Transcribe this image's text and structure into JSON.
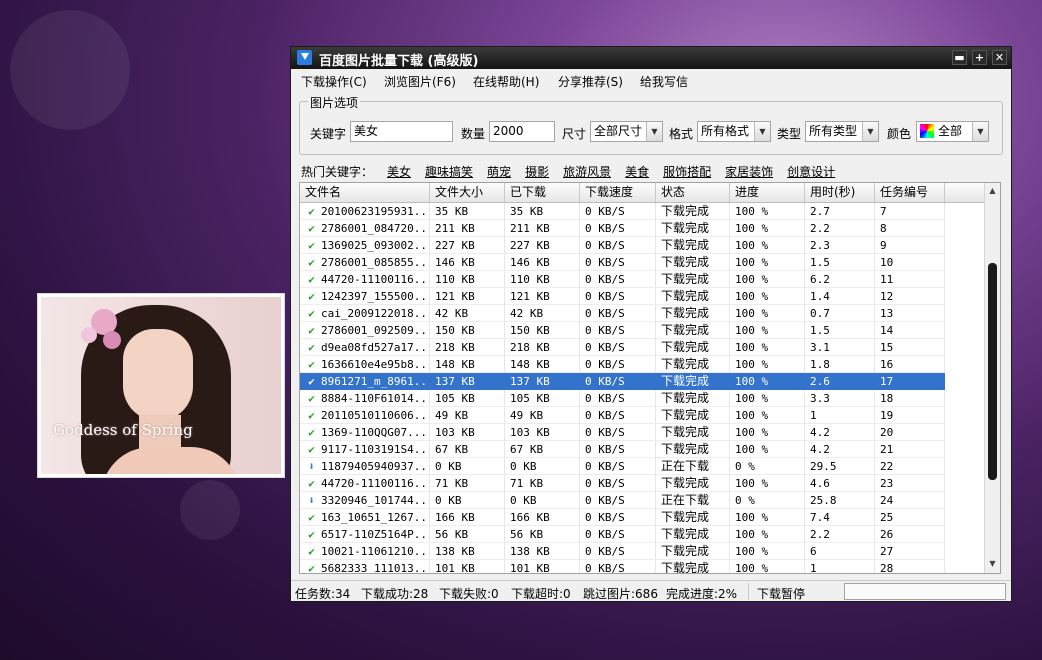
{
  "window": {
    "title": "百度图片批量下载 (高级版)",
    "controls": {
      "minimize": "▬",
      "maximize": "+",
      "close": "✕"
    }
  },
  "menu": [
    "下载操作(C)",
    "浏览图片(F6)",
    "在线帮助(H)",
    "分享推荐(S)",
    "给我写信"
  ],
  "options": {
    "legend": "图片选项",
    "keyword_label": "关键字",
    "keyword_value": "美女",
    "count_label": "数量",
    "count_value": "2000",
    "size_label": "尺寸",
    "size_value": "全部尺寸",
    "format_label": "格式",
    "format_value": "所有格式",
    "type_label": "类型",
    "type_value": "所有类型",
    "color_label": "颜色",
    "color_value": "全部"
  },
  "hot_keywords": {
    "label": "热门关键字：",
    "items": [
      "美女",
      "趣味搞笑",
      "萌宠",
      "摄影",
      "旅游风景",
      "美食",
      "服饰搭配",
      "家居装饰",
      "创意设计"
    ]
  },
  "table": {
    "columns": [
      "文件名",
      "文件大小",
      "已下载",
      "下载速度",
      "状态",
      "进度",
      "用时(秒)",
      "任务编号"
    ],
    "selected_index": 10,
    "rows": [
      {
        "icon": "check-icon",
        "name": "20100623195931...",
        "size": "35 KB",
        "done": "35 KB",
        "speed": "0 KB/S",
        "status": "下载完成",
        "progress": "100 %",
        "time": "2.7",
        "id": "7"
      },
      {
        "icon": "check-icon",
        "name": "2786001_084720...",
        "size": "211 KB",
        "done": "211 KB",
        "speed": "0 KB/S",
        "status": "下载完成",
        "progress": "100 %",
        "time": "2.2",
        "id": "8"
      },
      {
        "icon": "check-icon",
        "name": "1369025_093002...",
        "size": "227 KB",
        "done": "227 KB",
        "speed": "0 KB/S",
        "status": "下载完成",
        "progress": "100 %",
        "time": "2.3",
        "id": "9"
      },
      {
        "icon": "check-icon",
        "name": "2786001_085855...",
        "size": "146 KB",
        "done": "146 KB",
        "speed": "0 KB/S",
        "status": "下载完成",
        "progress": "100 %",
        "time": "1.5",
        "id": "10"
      },
      {
        "icon": "check-icon",
        "name": "44720-11100116...",
        "size": "110 KB",
        "done": "110 KB",
        "speed": "0 KB/S",
        "status": "下载完成",
        "progress": "100 %",
        "time": "6.2",
        "id": "11"
      },
      {
        "icon": "check-icon",
        "name": "1242397_155500...",
        "size": "121 KB",
        "done": "121 KB",
        "speed": "0 KB/S",
        "status": "下载完成",
        "progress": "100 %",
        "time": "1.4",
        "id": "12"
      },
      {
        "icon": "check-icon",
        "name": "cai_2009122018...",
        "size": "42 KB",
        "done": "42 KB",
        "speed": "0 KB/S",
        "status": "下载完成",
        "progress": "100 %",
        "time": "0.7",
        "id": "13"
      },
      {
        "icon": "check-icon",
        "name": "2786001_092509...",
        "size": "150 KB",
        "done": "150 KB",
        "speed": "0 KB/S",
        "status": "下载完成",
        "progress": "100 %",
        "time": "1.5",
        "id": "14"
      },
      {
        "icon": "check-icon",
        "name": "d9ea08fd527a17...",
        "size": "218 KB",
        "done": "218 KB",
        "speed": "0 KB/S",
        "status": "下载完成",
        "progress": "100 %",
        "time": "3.1",
        "id": "15"
      },
      {
        "icon": "check-icon",
        "name": "1636610e4e95b8...",
        "size": "148 KB",
        "done": "148 KB",
        "speed": "0 KB/S",
        "status": "下载完成",
        "progress": "100 %",
        "time": "1.8",
        "id": "16"
      },
      {
        "icon": "check-icon",
        "name": "8961271_m_8961...",
        "size": "137 KB",
        "done": "137 KB",
        "speed": "0 KB/S",
        "status": "下载完成",
        "progress": "100 %",
        "time": "2.6",
        "id": "17"
      },
      {
        "icon": "check-icon",
        "name": "8884-110F61014...",
        "size": "105 KB",
        "done": "105 KB",
        "speed": "0 KB/S",
        "status": "下载完成",
        "progress": "100 %",
        "time": "3.3",
        "id": "18"
      },
      {
        "icon": "check-icon",
        "name": "20110510110606...",
        "size": "49 KB",
        "done": "49 KB",
        "speed": "0 KB/S",
        "status": "下载完成",
        "progress": "100 %",
        "time": "1",
        "id": "19"
      },
      {
        "icon": "check-icon",
        "name": "1369-110QQG07...",
        "size": "103 KB",
        "done": "103 KB",
        "speed": "0 KB/S",
        "status": "下载完成",
        "progress": "100 %",
        "time": "4.2",
        "id": "20"
      },
      {
        "icon": "check-icon",
        "name": "9117-1103191S4...",
        "size": "67 KB",
        "done": "67 KB",
        "speed": "0 KB/S",
        "status": "下载完成",
        "progress": "100 %",
        "time": "4.2",
        "id": "21"
      },
      {
        "icon": "download-icon",
        "name": "11879405940937...",
        "size": "0 KB",
        "done": "0 KB",
        "speed": "0 KB/S",
        "status": "正在下载",
        "progress": "0 %",
        "time": "29.5",
        "id": "22"
      },
      {
        "icon": "check-icon",
        "name": "44720-11100116...",
        "size": "71 KB",
        "done": "71 KB",
        "speed": "0 KB/S",
        "status": "下载完成",
        "progress": "100 %",
        "time": "4.6",
        "id": "23"
      },
      {
        "icon": "download-icon",
        "name": "3320946_101744...",
        "size": "0 KB",
        "done": "0 KB",
        "speed": "0 KB/S",
        "status": "正在下载",
        "progress": "0 %",
        "time": "25.8",
        "id": "24"
      },
      {
        "icon": "check-icon",
        "name": "163_10651_1267...",
        "size": "166 KB",
        "done": "166 KB",
        "speed": "0 KB/S",
        "status": "下载完成",
        "progress": "100 %",
        "time": "7.4",
        "id": "25"
      },
      {
        "icon": "check-icon",
        "name": "6517-110Z5164P...",
        "size": "56 KB",
        "done": "56 KB",
        "speed": "0 KB/S",
        "status": "下载完成",
        "progress": "100 %",
        "time": "2.2",
        "id": "26"
      },
      {
        "icon": "check-icon",
        "name": "10021-11061210...",
        "size": "138 KB",
        "done": "138 KB",
        "speed": "0 KB/S",
        "status": "下载完成",
        "progress": "100 %",
        "time": "6",
        "id": "27"
      },
      {
        "icon": "check-icon",
        "name": "5682333_111013...",
        "size": "101 KB",
        "done": "101 KB",
        "speed": "0 KB/S",
        "status": "下载完成",
        "progress": "100 %",
        "time": "1",
        "id": "28"
      }
    ]
  },
  "status": {
    "tasks": "任务数:34",
    "success": "下载成功:28",
    "failed": "下载失败:0",
    "timeout": "下载超时:0",
    "skipped": "跳过图片:686",
    "progress": "完成进度:2%",
    "state": "下载暂停"
  },
  "preview": {
    "caption": "Goddess of Spring"
  },
  "colors": {
    "selection": "#3473cc",
    "ok": "#2ea028",
    "download": "#2d7fd8"
  }
}
